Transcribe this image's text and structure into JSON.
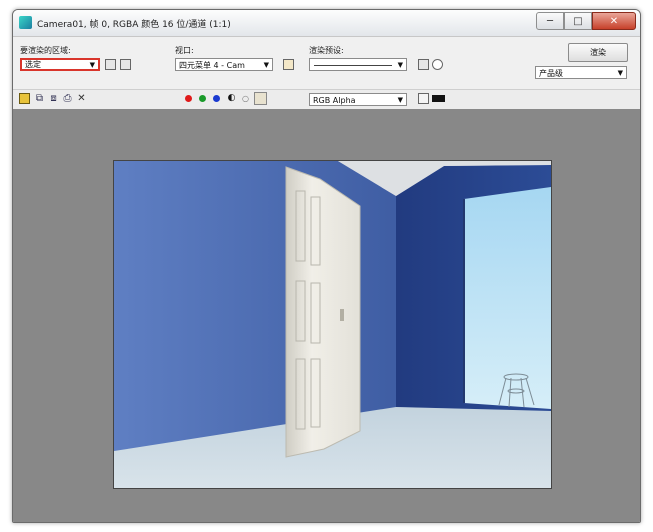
{
  "window": {
    "title": "Camera01, 帧 0, RGBA 颜色 16 位/通道 (1:1)",
    "minimize_glyph": "─",
    "maximize_glyph": "□",
    "close_glyph": "✕"
  },
  "controls": {
    "area_label": "要渲染的区域:",
    "area_value": "选定",
    "viewport_label": "视口:",
    "viewport_value": "四元菜单 4 - Cam",
    "preset_label": "渲染预设:",
    "preset_value": "",
    "render_button": "渲染",
    "mode_value": "产品级"
  },
  "toolbar": {
    "channel_value": "RGB Alpha"
  },
  "colors": {
    "red_channel": "#e01a1a",
    "green_channel": "#1a9a2a",
    "blue_channel": "#1a3ad0",
    "wall": "#33539a",
    "door": "#e9e7df",
    "floor": "#c9d7e0",
    "window_sky": "#b8dcf0"
  }
}
